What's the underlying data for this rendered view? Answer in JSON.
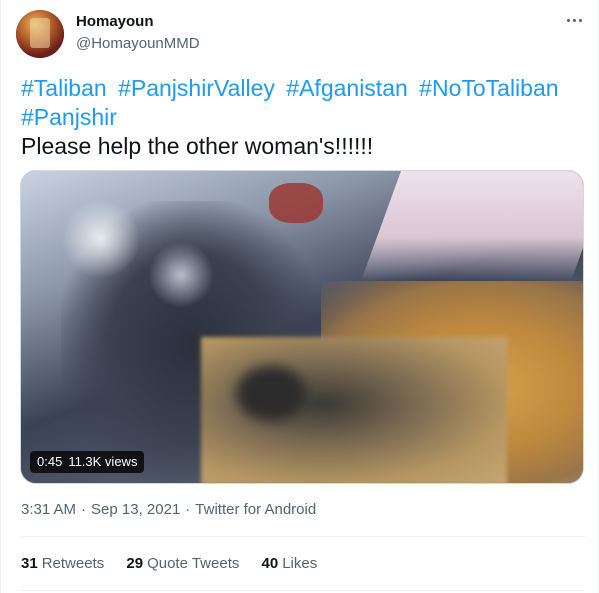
{
  "user": {
    "name": "Homayoun",
    "handle": "@HomayounMMD"
  },
  "tweet": {
    "hashtags": [
      "#Taliban",
      "#PanjshirValley",
      "#Afganistan",
      "#NoToTaliban",
      "#Panjshir"
    ],
    "text": "Please help the other woman's!!!!!!"
  },
  "media": {
    "duration": "0:45",
    "views": "11.3K views"
  },
  "meta": {
    "time": "3:31 AM",
    "separator": "·",
    "date": "Sep 13, 2021",
    "source": "Twitter for Android"
  },
  "stats": {
    "retweets": {
      "count": "31",
      "label": "Retweets"
    },
    "quotes": {
      "count": "29",
      "label": "Quote Tweets"
    },
    "likes": {
      "count": "40",
      "label": "Likes"
    }
  },
  "colors": {
    "link": "#1d9bf0",
    "secondary": "#536471"
  },
  "icons": [
    "more-options-icon"
  ]
}
